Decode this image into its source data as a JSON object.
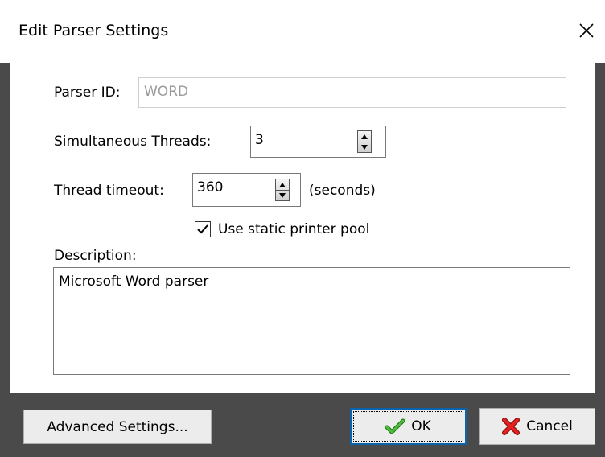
{
  "window": {
    "title": "Edit Parser Settings",
    "close_icon": "close-icon"
  },
  "form": {
    "parser_id_label": "Parser ID:",
    "parser_id_value": "WORD",
    "threads_label": "Simultaneous Threads:",
    "threads_value": "3",
    "timeout_label": "Thread timeout:",
    "timeout_value": "360",
    "timeout_unit": "(seconds)",
    "static_pool_label": "Use static printer pool",
    "static_pool_checked": true,
    "description_label": "Description:",
    "description_value": "Microsoft Word parser"
  },
  "buttons": {
    "advanced_label": "Advanced Settings...",
    "ok_label": "OK",
    "cancel_label": "Cancel"
  },
  "colors": {
    "frame": "#4a4a4a",
    "ok_check": "#2e9a1e",
    "cancel_x": "#d41414",
    "default_button_border": "#0a64ad"
  }
}
